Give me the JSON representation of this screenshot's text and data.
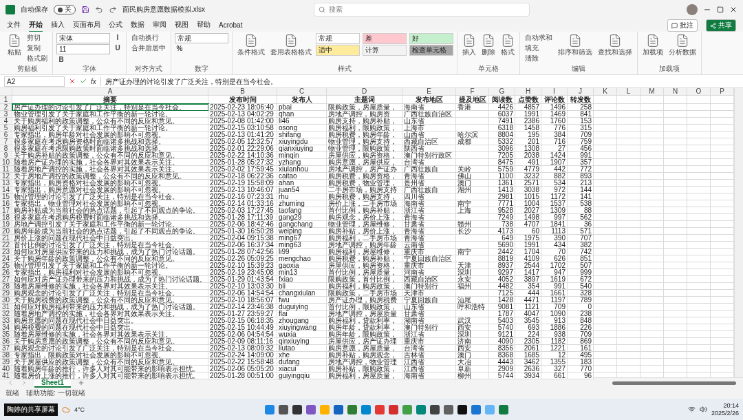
{
  "title_bar": {
    "autosave_label": "自动保存",
    "autosave_on": false,
    "autosave_state": "关",
    "filename": "面民购房意愿数据模拟.xlsx",
    "search_placeholder": "搜索"
  },
  "menu_tabs": [
    {
      "label": "文件",
      "selected": false
    },
    {
      "label": "开始",
      "selected": true
    },
    {
      "label": "插入",
      "selected": false
    },
    {
      "label": "页面布局",
      "selected": false
    },
    {
      "label": "公式",
      "selected": false
    },
    {
      "label": "数据",
      "selected": false
    },
    {
      "label": "审阅",
      "selected": false
    },
    {
      "label": "视图",
      "selected": false
    },
    {
      "label": "帮助",
      "selected": false
    },
    {
      "label": "Acrobat",
      "selected": false
    }
  ],
  "comment_button": "批注",
  "share_button": "共享",
  "ribbon_groups": [
    {
      "label": "剪贴板",
      "items": [
        {
          "kind": "large",
          "label": "粘贴"
        },
        {
          "kind": "small",
          "label": "剪切"
        },
        {
          "kind": "small",
          "label": "复制"
        },
        {
          "kind": "small",
          "label": "格式刷"
        }
      ]
    },
    {
      "label": "字体",
      "items": [
        {
          "kind": "field",
          "label": "宋体"
        },
        {
          "kind": "field",
          "label": "11"
        },
        {
          "kind": "glyph",
          "label": "B"
        },
        {
          "kind": "glyph",
          "label": "I"
        },
        {
          "kind": "glyph",
          "label": "U"
        }
      ]
    },
    {
      "label": "对齐方式",
      "items": [
        {
          "kind": "small",
          "label": "自动换行"
        },
        {
          "kind": "small",
          "label": "合并后居中"
        }
      ]
    },
    {
      "label": "数字",
      "items": [
        {
          "kind": "field",
          "label": "常规"
        },
        {
          "kind": "glyph",
          "label": "%"
        }
      ]
    },
    {
      "label": "样式",
      "items": [
        {
          "kind": "large",
          "label": "条件格式"
        },
        {
          "kind": "large",
          "label": "套用表格格式"
        },
        {
          "kind": "tile",
          "label": "常规",
          "color": "#ffffff"
        },
        {
          "kind": "tile",
          "label": "适中",
          "color": "#ffeb9c"
        },
        {
          "kind": "tile",
          "label": "差",
          "color": "#ffc7ce"
        },
        {
          "kind": "tile",
          "label": "计算",
          "color": "#f2f2f2"
        },
        {
          "kind": "tile",
          "label": "好",
          "color": "#c6efce"
        },
        {
          "kind": "tile",
          "label": "检查单元格",
          "color": "#a5a5a5"
        }
      ]
    },
    {
      "label": "单元格",
      "items": [
        {
          "kind": "large",
          "label": "插入"
        },
        {
          "kind": "large",
          "label": "删除"
        },
        {
          "kind": "large",
          "label": "格式"
        }
      ]
    },
    {
      "label": "编辑",
      "items": [
        {
          "kind": "small",
          "label": "自动求和"
        },
        {
          "kind": "small",
          "label": "填充"
        },
        {
          "kind": "small",
          "label": "清除"
        },
        {
          "kind": "large",
          "label": "排序和筛选"
        },
        {
          "kind": "large",
          "label": "查找和选择"
        }
      ]
    },
    {
      "label": "加载项",
      "items": [
        {
          "kind": "large",
          "label": "加载项"
        },
        {
          "kind": "large",
          "label": "分析数据"
        }
      ]
    }
  ],
  "formula_bar": {
    "cell_ref": "A2",
    "function_label": "fx",
    "formula": "房产证办理的讨论引发了广泛关注，特别是在当今社会。"
  },
  "sheet": {
    "column_letters": [
      "A",
      "B",
      "C",
      "D",
      "E",
      "F",
      "G",
      "H",
      "I",
      "J",
      "K",
      "L",
      "M",
      "N",
      "O",
      "P"
    ],
    "header_row_number": "1",
    "header": [
      "摘要",
      "发布时间",
      "发布人",
      "主题词",
      "发布地区",
      "提及地区",
      "阅读数",
      "点赞数",
      "评论数",
      "转发数"
    ],
    "rows": [
      {
        "number": "2",
        "selected": true,
        "cells": [
          "房产证办理的讨论引发了广泛关注，特别是在当今社会。",
          "2025-02-23 18:06:40",
          "pbai",
          "限购政策，房屋质量，",
          "海南省",
          "香港",
          "4426",
          "4857",
          "1496",
          "258"
        ]
      },
      {
        "number": "3",
        "selected": false,
        "cells": [
          "物业管理引发了关于家庭和工作平衡的新一轮讨论。",
          "2025-02-13 04:02:29",
          "qhan",
          "房地产调控，购房资",
          "广西壮族自治区",
          "",
          "6037",
          "1991",
          "1469",
          "841"
        ]
      },
      {
        "number": "4",
        "selected": false,
        "cells": [
          "关于购房福利的政策调整，公众有不同的反应和意见。",
          "2025-02-08 01:42:00",
          "li46",
          "购房支持，购房补贴，",
          "山东省",
          "",
          "7491",
          "2386",
          "1760",
          "153"
        ]
      },
      {
        "number": "5",
        "selected": false,
        "cells": [
          "购房福利引发了关于家庭和工作平衡的新一轮讨论。",
          "2025-02-15 03:10:58",
          "osong",
          "购房福利，限购政策，",
          "上海市",
          "",
          "6318",
          "1458",
          "776",
          "315"
        ]
      },
      {
        "number": "6",
        "selected": false,
        "cells": [
          "专家指出，购房年龄对社会发展的影响不可忽视。",
          "2025-02-13 01:41:20",
          "shifang",
          "购房税费，购房年龄，",
          "山西省",
          "哈尔滨",
          "8804",
          "195",
          "384",
          "709"
        ]
      },
      {
        "number": "7",
        "selected": false,
        "cells": [
          "很多家庭在考虑购房资格时面临诸多挑战和选择。",
          "2025-02-05 12:32:57",
          "xiuyingdu",
          "物业管理，购房支持，",
          "西藏自治区",
          "成都",
          "5332",
          "201",
          "716",
          "759"
        ]
      },
      {
        "number": "8",
        "selected": false,
        "cells": [
          "很多家庭在考虑限购政策时面临诸多挑战和选择。",
          "2025-02-01 22:29:06",
          "qianxiuying",
          "物业管理，限购政策，",
          "陕西省",
          "",
          "3096",
          "1308",
          "27",
          "456"
        ]
      },
      {
        "number": "9",
        "selected": false,
        "cells": [
          "关于购房补贴的政策调整，公众有不同的反应和意见。",
          "2025-02-22 14:10:36",
          "minqin",
          "房屋供应，购房资格，",
          "澳门特别行政区",
          "",
          "7205",
          "2038",
          "1424",
          "991"
        ]
      },
      {
        "number": "10",
        "selected": false,
        "cells": [
          "随着房产证办理的实施，社会各界对其效果表示关注。",
          "2025-01-28 05:27:32",
          "yzhang",
          "购房意愿，房屋供应，",
          "台湾省",
          "",
          "8475",
          "491",
          "1907",
          "357"
        ]
      },
      {
        "number": "11",
        "selected": false,
        "cells": [
          "随着房地产调控的实施，社会各界对其效果表示关注。",
          "2025-02-02 17:59:45",
          "xiulanhou",
          "房地产调控，房产证办",
          "广西壮族自",
          "关岭",
          "5759",
          "4779",
          "442",
          "772"
        ]
      },
      {
        "number": "12",
        "selected": false,
        "cells": [
          "关于房地产调控的政策调整，公众有不同的反应和意见。",
          "2025-02-18 06:22:36",
          "caitao",
          "购房税费，购房资格，",
          "青海省",
          "佛山",
          "1100",
          "3232",
          "882",
          "893"
        ]
      },
      {
        "number": "13",
        "selected": false,
        "cells": [
          "专家指出，购房资格对社会发展的影响不可忽视。",
          "2025-02-19 15:58:09",
          "ahan",
          "购房税费，物业管理，",
          "贵州省",
          "澳门",
          "1361",
          "2571",
          "534",
          "213"
        ]
      },
      {
        "number": "14",
        "selected": false,
        "cells": [
          "专家指出，购房意愿对社会发展的影响不可忽视。",
          "2025-02-13 10:46:07",
          "juan54",
          "二手房市场，购房支持",
          "广西壮族自",
          "湖州",
          "1413",
          "3038",
          "972",
          "144"
        ]
      },
      {
        "number": "15",
        "selected": false,
        "cells": [
          "物业管理的讨论引发了广泛关注，特别是在当今社会。",
          "2025-02-16 07:23:31",
          "rhu",
          "购房税费，购房支持，",
          "四川省",
          "",
          "2981",
          "1015",
          "1172",
          "141"
        ]
      },
      {
        "number": "16",
        "selected": false,
        "cells": [
          "专家指出，物业管理对社会发展的影响不可忽视。",
          "2025-02-14 01:33:16",
          "zhuming",
          "房价上涨，二手房市场",
          "海南省",
          "南宁",
          "7771",
          "1004",
          "1537",
          "538"
        ]
      },
      {
        "number": "17",
        "selected": false,
        "cells": [
          "购房补贴成为当前社会的热点话题，引起了不同观点的争论。",
          "2025-02-03 17:27:45",
          "taofang",
          "首付比例，购房补贴，",
          "浙江省",
          "上海",
          "9528",
          "2027",
          "1309",
          "88"
        ]
      },
      {
        "number": "18",
        "selected": false,
        "cells": [
          "很多家庭在考虑购房税费时面临诸多挑战和选择。",
          "2025-01-28 17:11:39",
          "gang29",
          "购房观念，房价上涨，",
          "青海省",
          "",
          "7249",
          "1498",
          "997",
          "562"
        ]
      },
      {
        "number": "19",
        "selected": false,
        "cells": [
          "房地产调控引发了关于家庭和工作平衡的新一轮讨论。",
          "2025-02-06 18:42:46",
          "gangchang",
          "物业管理，房屋维修，",
          "甘肃省",
          "赣州",
          "738",
          "4707",
          "1841",
          "36"
        ]
      },
      {
        "number": "20",
        "selected": false,
        "cells": [
          "购房年龄成为当前社会的热点话题，引起了不同观点的争论。",
          "2025-01-30 16:50:28",
          "weiping",
          "购房补贴，房价上涨，",
          "青海省",
          "长沙",
          "4173",
          "60",
          "1113",
          "571"
        ]
      },
      {
        "number": "21",
        "selected": false,
        "cells": [
          "房价上涨的问题在现代社会中日益突出。",
          "2025-02-04 09:15:38",
          "ming67",
          "购房福利，二手房市场",
          "青海省",
          "",
          "649",
          "1975",
          "390",
          "707"
        ]
      },
      {
        "number": "22",
        "selected": false,
        "cells": [
          "首付比例的讨论引发了广泛关注，特别是在当今社会。",
          "2025-02-06 16:37:34",
          "ming63",
          "房地产调控，购房年龄",
          "云南省",
          "",
          "5690",
          "1991",
          "434",
          "382"
        ]
      },
      {
        "number": "23",
        "selected": false,
        "cells": [
          "如何应对房屋供应带来的压力和挑战，成为了热门讨论话题。",
          "2025-01-28 07:42:56",
          "li99",
          "购房福利，房屋维修，",
          "重庆市",
          "南宁",
          "2442",
          "1704",
          "70",
          "742"
        ]
      },
      {
        "number": "24",
        "selected": false,
        "cells": [
          "关于购房年龄的政策调整，公众有不同的反应和意见。",
          "2025-02-26 05:09:25",
          "mengchao",
          "购房税费，购房补贴，",
          "宁夏回族自治区",
          "",
          "8819",
          "4109",
          "626",
          "851"
        ]
      },
      {
        "number": "25",
        "selected": false,
        "cells": [
          "物业管理引发了关于家庭和工作平衡的新一轮讨论。",
          "2025-02-10 15:39:23",
          "gaoxia",
          "房屋供应，购房资格，",
          "重庆市",
          "天津",
          "8937",
          "2544",
          "1702",
          "507"
        ]
      },
      {
        "number": "26",
        "selected": false,
        "cells": [
          "专家指出，购房福利对社会发展的影响不可忽视。",
          "2025-02-19 23:45:08",
          "min13",
          "首付比例，房屋质量，",
          "河南省",
          "深圳",
          "9297",
          "1417",
          "947",
          "999"
        ]
      },
      {
        "number": "27",
        "selected": false,
        "cells": [
          "如何应对房产证办理带来的压力和挑战，成为了热门讨论话题。",
          "2025-01-29 01:43:54",
          "fxiao",
          "限购政策，首付比例，",
          "西藏自治区",
          "永安",
          "4052",
          "3897",
          "1619",
          "672"
        ]
      },
      {
        "number": "28",
        "selected": false,
        "cells": [
          "随着房屋维修的实施，社会各界对其效果表示关注。",
          "2025-02-10 13:03:30",
          "bli",
          "购房福利，购房政策，",
          "澳门特别行",
          "福州",
          "4482",
          "354",
          "991",
          "540"
        ]
      },
      {
        "number": "29",
        "selected": false,
        "cells": [
          "购房观念的讨论引发了广泛关注，特别是在当今社会。",
          "2025-02-06 14:54:54",
          "changxiulan",
          "限购政策，二手房市场",
          "天津市",
          "",
          "7125",
          "444",
          "1661",
          "328"
        ]
      },
      {
        "number": "30",
        "selected": false,
        "cells": [
          "关于购房税费的政策调整，公众有不同的反应和意见。",
          "2025-02-10 18:56:07",
          "fwu",
          "房产证办理，购房税费",
          "宁夏回族自",
          "汕尾",
          "1428",
          "4471",
          "1197",
          "789"
        ]
      },
      {
        "number": "31",
        "selected": false,
        "cells": [
          "如何应对购房福利带来的压力和挑战，成为了热门讨论话题。",
          "2025-02-14 23:46:38",
          "duguiying",
          "首付比例，限购政策，",
          "山东省",
          "呼和浩特",
          "9081",
          "1121",
          "709",
          "0"
        ]
      },
      {
        "number": "32",
        "selected": false,
        "cells": [
          "随着房地产调控的实施，社会各界对其效果表示关注。",
          "2025-01-27 23:59:27",
          "flai",
          "房地产调控，房屋质量",
          "甘肃省",
          "",
          "1787",
          "4047",
          "1090",
          "238"
        ]
      },
      {
        "number": "33",
        "selected": false,
        "cells": [
          "购房意愿的问题在现代社会中日益突出。",
          "2025-02-15 06:18:35",
          "zhougang",
          "购房福利，贷款利率，",
          "湖南省",
          "武汉",
          "5403",
          "3545",
          "913",
          "848"
        ]
      },
      {
        "number": "34",
        "selected": false,
        "cells": [
          "购房税费的问题在现代社会中日益突出。",
          "2025-02-15 10:44:49",
          "xiuyingwang",
          "购房年龄，贷款利率，",
          "澳门特别行",
          "西安",
          "5740",
          "693",
          "1886",
          "226"
        ]
      },
      {
        "number": "35",
        "selected": false,
        "cells": [
          "随着房屋维修的实施，社会各界对其效果表示关注。",
          "2025-02-06 04:54:54",
          "wuxia",
          "购房年龄，限购政策，",
          "浙江省",
          "深圳",
          "9121",
          "224",
          "938",
          "709"
        ]
      },
      {
        "number": "36",
        "selected": false,
        "cells": [
          "关于购房意愿的政策调整，公众有不同的反应和意见。",
          "2025-02-09 08:11:16",
          "qinxiuying",
          "房屋供应，房产证办理",
          "重庆市",
          "济南",
          "4090",
          "2305",
          "1182",
          "869"
        ]
      },
      {
        "number": "37",
        "selected": false,
        "cells": [
          "购房观念的讨论引发了广泛关注，特别是在当今社会。",
          "2025-02-13 08:09:32",
          "liutao",
          "购房意愿，房屋质量，",
          "台湾省",
          "西安",
          "8356",
          "2061",
          "1221",
          "161"
        ]
      },
      {
        "number": "38",
        "selected": false,
        "cells": [
          "专家指出，限购政策对社会发展的影响不可忽视。",
          "2025-02-24 14:09:00",
          "xhe",
          "购房补贴，购房观念，",
          "吉林省",
          "澳门",
          "8368",
          "1685",
          "12",
          "495"
        ]
      },
      {
        "number": "39",
        "selected": false,
        "cells": [
          "关于房屋供应的政策调整，公众有不同的反应和意见。",
          "2025-02-22 15:58:48",
          "dufang",
          "房地产调控，物业管理",
          "江西省",
          "大冶",
          "4443",
          "3462",
          "1355",
          "183"
        ]
      },
      {
        "number": "40",
        "selected": false,
        "cells": [
          "随着购房年龄的推行，许多人对其可能带来的影响表示担忧。",
          "2025-02-06 05:05:20",
          "xiacui",
          "购房补贴，限购政策，",
          "江西省",
          "阜新",
          "2909",
          "2636",
          "327",
          "770"
        ]
      },
      {
        "number": "41",
        "selected": false,
        "cells": [
          "随着房价上涨的推行，许多人对其可能带来的影响表示担忧。",
          "2025-01-28 00:51:00",
          "guiyingqiu",
          "购房福利，房屋质量，",
          "海南省",
          "柳州",
          "5744",
          "3934",
          "661",
          "96"
        ]
      }
    ]
  },
  "sheet_tabs": [
    {
      "label": "Sheet1",
      "selected": true
    }
  ],
  "status_bar": {
    "mode": "就绪",
    "accessibility": "辅助功能: 一切就绪"
  },
  "taskbar": {
    "weather": "4°C",
    "time": "20:14",
    "date": "2025/2/26"
  },
  "screen_share_label": "陶婷的共享屏幕"
}
